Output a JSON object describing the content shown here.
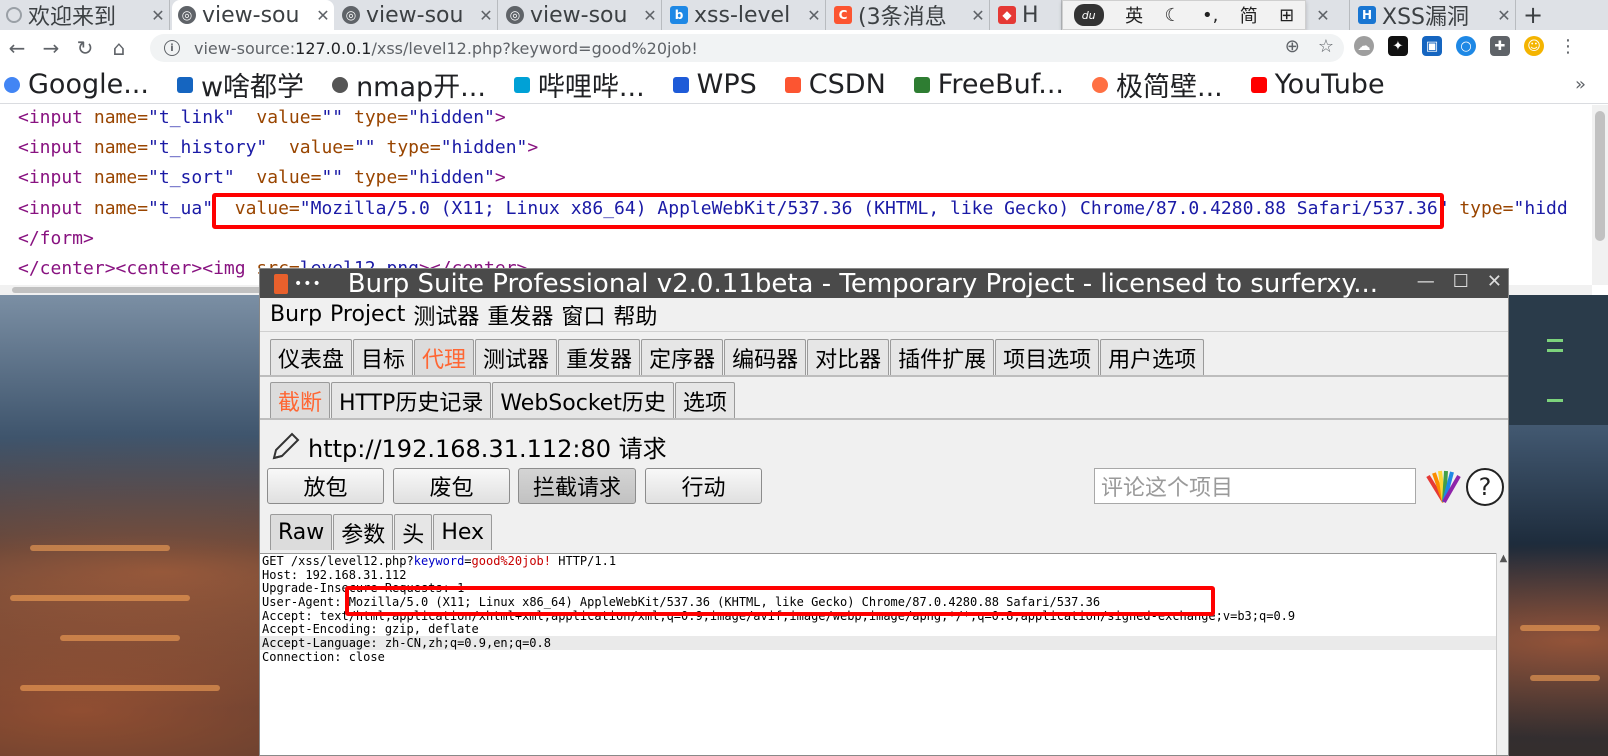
{
  "browser": {
    "tabs": [
      {
        "label": "欢迎来到",
        "icon": "loading-icon",
        "color": "#9aa0a6",
        "active": false
      },
      {
        "label": "view-sou",
        "icon": "globe-icon",
        "color": "#5f6368",
        "active": true
      },
      {
        "label": "view-sou",
        "icon": "globe-icon",
        "color": "#5f6368",
        "active": false
      },
      {
        "label": "view-sou",
        "icon": "globe-icon",
        "color": "#5f6368",
        "active": false
      },
      {
        "label": "xss-level",
        "icon": "bing-icon",
        "color": "#1e88e5",
        "active": false
      },
      {
        "label": "(3条消息",
        "icon": "csdn-icon",
        "color": "#fc5531",
        "active": false
      },
      {
        "label": "H",
        "icon": "huorong-icon",
        "color": "#e53935",
        "active": false
      },
      {
        "label": "XSS漏洞",
        "icon": "shield-icon",
        "color": "#1976d2",
        "active": false
      }
    ],
    "ime": {
      "lang": "英",
      "moon": "☾",
      "punct": "•,",
      "simplified": "简",
      "grid": "⊞",
      "logo": "du"
    },
    "url_prefix": "view-source:",
    "url_host": "127.0.0.1",
    "url_path": "/xss/level12.php?keyword=good%20job!",
    "bookmarks": [
      {
        "label": "Google...",
        "color": "#4285f4"
      },
      {
        "label": "w啥都学",
        "color": "#1565c0"
      },
      {
        "label": "nmap开...",
        "color": "#555555"
      },
      {
        "label": "哔哩哔...",
        "color": "#00a1d6"
      },
      {
        "label": "WPS",
        "color": "#1e5bd8"
      },
      {
        "label": "CSDN",
        "color": "#fc5531"
      },
      {
        "label": "FreeBuf...",
        "color": "#2e7d32"
      },
      {
        "label": "极简壁...",
        "color": "#ff7043"
      },
      {
        "label": "YouTube",
        "color": "#ff0000"
      }
    ],
    "bookmarks_more": "»",
    "source_lines": [
      {
        "tag_open": "<input ",
        "a1": "name=",
        "v1": "\"t_link\"",
        "a2": "  value=",
        "v2": "\"\"",
        "a3": " type=",
        "v3": "\"hidden\"",
        "close": ">"
      },
      {
        "tag_open": "<input ",
        "a1": "name=",
        "v1": "\"t_history\"",
        "a2": "  value=",
        "v2": "\"\"",
        "a3": " type=",
        "v3": "\"hidden\"",
        "close": ">"
      },
      {
        "tag_open": "<input ",
        "a1": "name=",
        "v1": "\"t_sort\"",
        "a2": "  value=",
        "v2": "\"\"",
        "a3": " type=",
        "v3": "\"hidden\"",
        "close": ">"
      },
      {
        "tag_open": "<input ",
        "a1": "name=",
        "v1": "\"t_ua\"",
        "a2": "  value=",
        "v2": "\"Mozilla/5.0 (X11; Linux x86_64) AppleWebKit/537.36 (KHTML, like Gecko) Chrome/87.0.4280.88 Safari/537.36\"",
        "a3": " type=",
        "v3": "\"hidd",
        "close": ""
      },
      {
        "tag_open": "</form>",
        "a1": "",
        "v1": "",
        "a2": "",
        "v2": "",
        "a3": "",
        "v3": "",
        "close": ""
      },
      {
        "tag_open": "</center><center><img ",
        "a1": "src=",
        "v1": "level12.png",
        "a2": "></center>",
        "v2": "",
        "a3": "",
        "v3": "",
        "close": ""
      }
    ]
  },
  "burp": {
    "title": "Burp Suite Professional v2.0.11beta - Temporary Project - licensed to surferxy...",
    "menu": [
      "Burp",
      "Project",
      "测试器",
      "重发器",
      "窗口",
      "帮助"
    ],
    "main_tabs": [
      "仪表盘",
      "目标",
      "代理",
      "测试器",
      "重发器",
      "定序器",
      "编码器",
      "对比器",
      "插件扩展",
      "项目选项",
      "用户选项"
    ],
    "main_tab_selected": "代理",
    "sub_tabs": [
      "截断",
      "HTTP历史记录",
      "WebSocket历史",
      "选项"
    ],
    "sub_tab_selected": "截断",
    "request_title": "http://192.168.31.112:80 请求",
    "buttons": {
      "forward": "放包",
      "drop": "废包",
      "intercept": "拦截请求",
      "action": "行动"
    },
    "comment_placeholder": "评论这个项目",
    "help": "?",
    "view_tabs": [
      "Raw",
      "参数",
      "头",
      "Hex"
    ],
    "view_tab_selected": "Raw",
    "request": {
      "line1_pre": "GET /xss/level12.php?",
      "line1_key": "keyword",
      "line1_eq": "=",
      "line1_val": "good%20job!",
      "line1_post": " HTTP/1.1",
      "host": "Host: 192.168.31.112",
      "upgrade": "Upgrade-Insecure-Requests: 1",
      "ua_name": "User-Agent: ",
      "ua_value": "Mozilla/5.0 (X11; Linux x86_64) AppleWebKit/537.36 (KHTML, like Gecko) Chrome/87.0.4280.88 Safari/537.36",
      "accept": "Accept: text/html,application/xhtml+xml,application/xml;q=0.9,image/avif,image/webp,image/apng,*/*;q=0.8,application/signed-exchange;v=b3;q=0.9",
      "encoding": "Accept-Encoding: gzip, deflate",
      "language": "Accept-Language: zh-CN,zh;q=0.9,en;q=0.8",
      "connection": "Connection: close"
    }
  }
}
